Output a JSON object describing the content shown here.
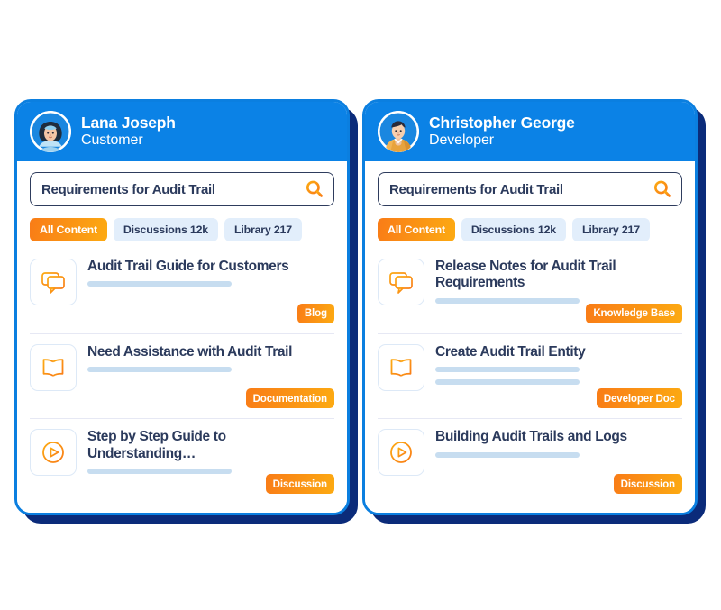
{
  "colors": {
    "header_blue": "#0b82e6",
    "card_border_blue": "#0b7fe0",
    "backing_navy": "#0b2b7a",
    "accent_orange": "#f97c17",
    "accent_amber": "#fcaa12",
    "chip_inactive_bg": "#e2eefb",
    "text_navy": "#2b3a5c",
    "bar_blue": "#c7ddf0",
    "divider": "#e6e8f4"
  },
  "cards": [
    {
      "id": "customer-card",
      "header": {
        "name": "Lana Joseph",
        "role": "Customer",
        "avatar_icon": "avatar-woman"
      },
      "search": {
        "value": "Requirements for Audit Trail",
        "placeholder": "Requirements for Audit Trail",
        "icon": "search-icon"
      },
      "chips": [
        {
          "label": "All Content",
          "active": true
        },
        {
          "label": "Discussions 12k",
          "active": false
        },
        {
          "label": "Library 217",
          "active": false
        }
      ],
      "results": [
        {
          "icon": "chat-bubbles-icon",
          "title": "Audit Trail Guide for Customers",
          "bars": 1,
          "tag": "Blog"
        },
        {
          "icon": "open-book-icon",
          "title": "Need Assistance with Audit Trail",
          "bars": 1,
          "tag": "Documentation"
        },
        {
          "icon": "play-circle-icon",
          "title": "Step by Step Guide to Understanding…",
          "bars": 1,
          "tag": "Discussion"
        }
      ]
    },
    {
      "id": "developer-card",
      "header": {
        "name": "Christopher George",
        "role": "Developer",
        "avatar_icon": "avatar-man"
      },
      "search": {
        "value": "Requirements for Audit Trail",
        "placeholder": "Requirements for Audit Trail",
        "icon": "search-icon"
      },
      "chips": [
        {
          "label": "All Content",
          "active": true
        },
        {
          "label": "Discussions 12k",
          "active": false
        },
        {
          "label": "Library 217",
          "active": false
        }
      ],
      "results": [
        {
          "icon": "chat-bubbles-icon",
          "title": "Release Notes for Audit Trail Requirements",
          "bars": 1,
          "tag": "Knowledge Base"
        },
        {
          "icon": "open-book-icon",
          "title": "Create Audit Trail Entity",
          "bars": 2,
          "tag": "Developer Doc"
        },
        {
          "icon": "play-circle-icon",
          "title": "Building Audit Trails and Logs",
          "bars": 1,
          "tag": "Discussion"
        }
      ]
    }
  ]
}
